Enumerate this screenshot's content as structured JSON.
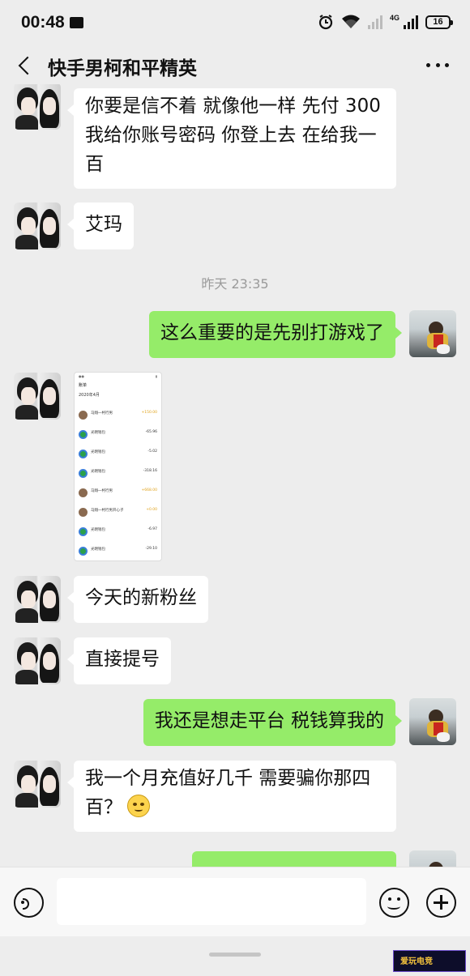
{
  "status_bar": {
    "time": "00:48",
    "network": "4G",
    "battery": "16"
  },
  "header": {
    "title": "快手男柯和平精英"
  },
  "messages": [
    {
      "from": "other",
      "text": "你要是信不着 就像他一样 先付 300 我给你账号密码  你登上去 在给我一百"
    },
    {
      "from": "other",
      "text": "艾玛"
    },
    {
      "type": "timestamp",
      "text": "昨天 23:35"
    },
    {
      "from": "me",
      "text": "这么重要的是先别打游戏了"
    },
    {
      "from": "other",
      "type": "image"
    },
    {
      "from": "other",
      "text": "今天的新粉丝"
    },
    {
      "from": "other",
      "text": "直接提号"
    },
    {
      "from": "me",
      "text": "我还是想走平台 税钱算我的"
    },
    {
      "from": "other",
      "text": "我一个月充值好几千 需要骗你那四百？",
      "emoji": "smile-emoji"
    }
  ],
  "screenshot_image": {
    "title": "账单",
    "month": "2020年4月",
    "rows": [
      {
        "name": "马翔一柯行男",
        "amount": "+150.00",
        "icon": "avatar"
      },
      {
        "name": "光明钱包",
        "amount": "-65.96",
        "icon": "app"
      },
      {
        "name": "光明钱包",
        "amount": "-5.02",
        "icon": "app"
      },
      {
        "name": "光明钱包",
        "amount": "-318.16",
        "icon": "app"
      },
      {
        "name": "马翔一柯行男",
        "amount": "+668.00",
        "icon": "avatar"
      },
      {
        "name": "马翔一柯行男开心子",
        "amount": "+0.00",
        "icon": "avatar"
      },
      {
        "name": "光明钱包",
        "amount": "-6.97",
        "icon": "app"
      },
      {
        "name": "光明钱包",
        "amount": "-29.10",
        "icon": "app"
      }
    ]
  },
  "watermark": "爱玩电竞"
}
